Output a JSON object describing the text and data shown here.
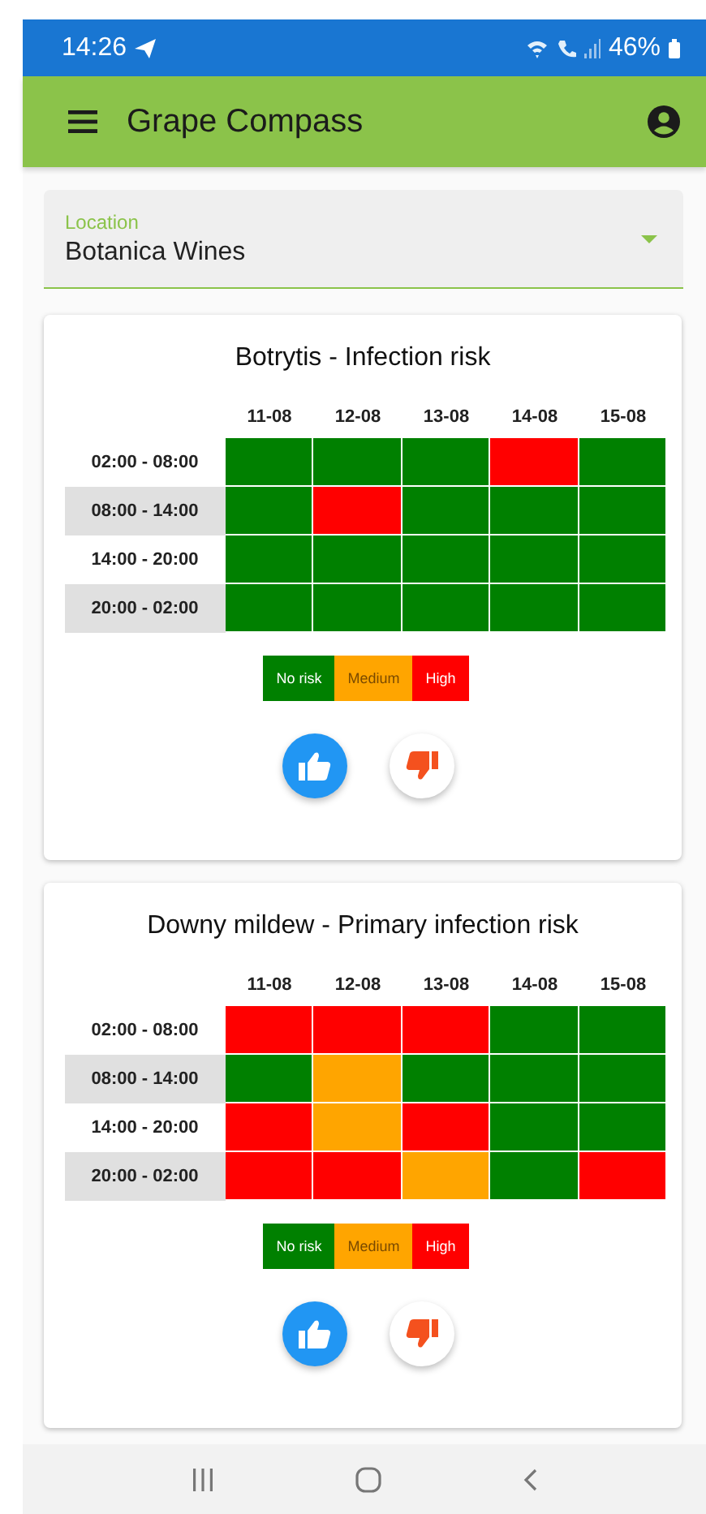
{
  "status_bar": {
    "time": "14:26",
    "battery": "46%"
  },
  "app_bar": {
    "title": "Grape Compass"
  },
  "location": {
    "label": "Location",
    "value": "Botanica Wines"
  },
  "cards": [
    {
      "title": "Botrytis - Infection risk",
      "dates": [
        "11-08",
        "12-08",
        "13-08",
        "14-08",
        "15-08"
      ],
      "rows": [
        {
          "period": "02:00 - 08:00",
          "shaded": false,
          "cells": [
            {
              "color": "#008000"
            },
            {
              "color": "#008000"
            },
            {
              "color": "#008000"
            },
            {
              "color": "#ff0000"
            },
            {
              "color": "#008000"
            }
          ]
        },
        {
          "period": "08:00 - 14:00",
          "shaded": true,
          "cells": [
            {
              "color": "#008000"
            },
            {
              "color": "#ff0000"
            },
            {
              "color": "#008000"
            },
            {
              "color": "#008000"
            },
            {
              "color": "#008000"
            }
          ]
        },
        {
          "period": "14:00 - 20:00",
          "shaded": false,
          "cells": [
            {
              "color": "#008000"
            },
            {
              "color": "#008000"
            },
            {
              "color": "#008000"
            },
            {
              "color": "#008000"
            },
            {
              "color": "#008000"
            }
          ]
        },
        {
          "period": "20:00 - 02:00",
          "shaded": true,
          "cells": [
            {
              "color": "#008000"
            },
            {
              "color": "#008000"
            },
            {
              "color": "#008000"
            },
            {
              "color": "#008000"
            },
            {
              "color": "#008000"
            }
          ]
        }
      ],
      "legend": [
        {
          "label": "No risk",
          "color": "#008000"
        },
        {
          "label": "Medium",
          "color": "#ffa500"
        },
        {
          "label": "High",
          "color": "#ff0000"
        }
      ]
    },
    {
      "title": "Downy mildew - Primary infection risk",
      "dates": [
        "11-08",
        "12-08",
        "13-08",
        "14-08",
        "15-08"
      ],
      "rows": [
        {
          "period": "02:00 - 08:00",
          "shaded": false,
          "cells": [
            {
              "color": "#ff0000"
            },
            {
              "color": "#ff0000"
            },
            {
              "color": "#ff0000"
            },
            {
              "color": "#008000"
            },
            {
              "color": "#008000"
            }
          ]
        },
        {
          "period": "08:00 - 14:00",
          "shaded": true,
          "cells": [
            {
              "color": "#008000"
            },
            {
              "color": "#ffa500"
            },
            {
              "color": "#008000"
            },
            {
              "color": "#008000"
            },
            {
              "color": "#008000"
            }
          ]
        },
        {
          "period": "14:00 - 20:00",
          "shaded": false,
          "cells": [
            {
              "color": "#ff0000"
            },
            {
              "color": "#ffa500"
            },
            {
              "color": "#ff0000"
            },
            {
              "color": "#008000"
            },
            {
              "color": "#008000"
            }
          ]
        },
        {
          "period": "20:00 - 02:00",
          "shaded": true,
          "cells": [
            {
              "color": "#ff0000"
            },
            {
              "color": "#ff0000"
            },
            {
              "color": "#ffa500"
            },
            {
              "color": "#008000"
            },
            {
              "color": "#ff0000"
            }
          ]
        }
      ],
      "legend": [
        {
          "label": "No risk",
          "color": "#008000"
        },
        {
          "label": "Medium",
          "color": "#ffa500"
        },
        {
          "label": "High",
          "color": "#ff0000"
        }
      ]
    }
  ]
}
